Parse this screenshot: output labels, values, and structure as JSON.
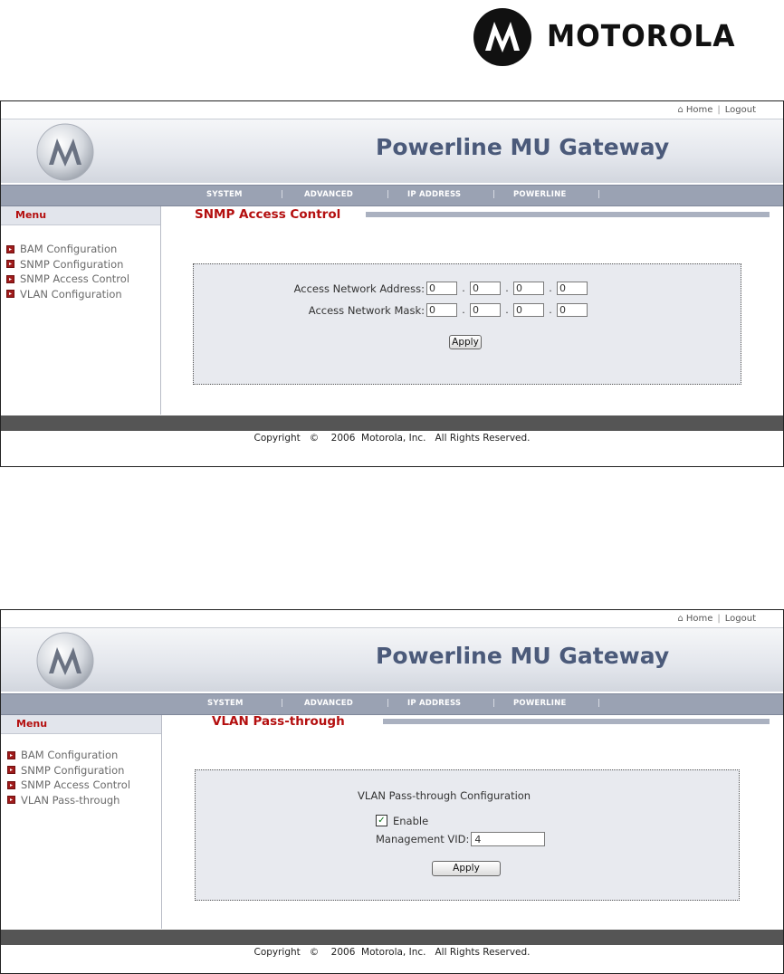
{
  "brand": {
    "name": "MOTOROLA"
  },
  "screens": [
    {
      "top_nav": {
        "home": "Home",
        "separator": "|",
        "logout": "Logout"
      },
      "app_title": "Powerline MU Gateway",
      "tabs": [
        "SYSTEM",
        "ADVANCED",
        "IP ADDRESS",
        "POWERLINE"
      ],
      "tab_separator": "|",
      "menu_heading": "Menu",
      "menu_items": [
        "BAM Configuration",
        "SNMP Configuration",
        "SNMP Access Control",
        "VLAN Configuration"
      ],
      "page_title": "SNMP Access Control",
      "form": {
        "address_label": "Access Network Address:",
        "address_octets": [
          "0",
          "0",
          "0",
          "0"
        ],
        "mask_label": "Access Network Mask:",
        "mask_octets": [
          "0",
          "0",
          "0",
          "0"
        ],
        "octet_separator": ".",
        "apply_label": "Apply"
      },
      "copyright": "Copyright   ©    2006  Motorola, Inc.   All Rights Reserved."
    },
    {
      "top_nav": {
        "home": "Home",
        "separator": "|",
        "logout": "Logout"
      },
      "app_title": "Powerline MU Gateway",
      "tabs": [
        "SYSTEM",
        "ADVANCED",
        "IP ADDRESS",
        "POWERLINE"
      ],
      "tab_separator": "|",
      "menu_heading": "Menu",
      "menu_items": [
        "BAM Configuration",
        "SNMP Configuration",
        "SNMP Access Control",
        "VLAN Pass-through"
      ],
      "page_title": "VLAN Pass-through",
      "form": {
        "heading": "VLAN Pass-through Configuration",
        "enable_label": "Enable",
        "enable_checked": true,
        "check_mark": "✓",
        "vid_label": "Management VID:",
        "vid_value": "4",
        "apply_label": "Apply"
      },
      "copyright": "Copyright   ©    2006  Motorola, Inc.   All Rights Reserved."
    }
  ],
  "colors": {
    "accent_red": "#b40f0f",
    "app_title_blue": "#4b5a7a",
    "tab_bar": "#9aa2b3",
    "panel_bg": "#e8eaef",
    "footer_bar": "#555555"
  },
  "icons": [
    "motorola-logo-icon",
    "home-icon",
    "menu-bullet-icon",
    "checkbox-checked-icon"
  ]
}
